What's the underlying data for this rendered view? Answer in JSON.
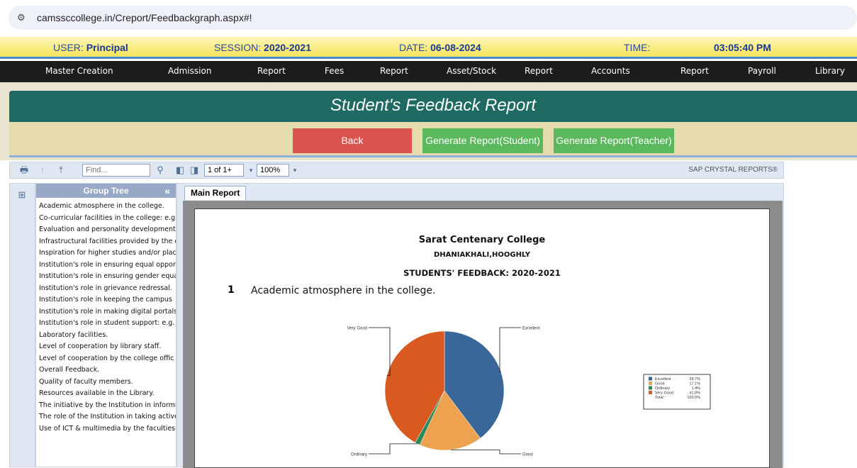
{
  "browser": {
    "url": "camssccollege.in/Creport/Feedbackgraph.aspx#!"
  },
  "info": {
    "user_label": "USER:",
    "user_value": "Principal",
    "session_label": "SESSION:",
    "session_value": "2020-2021",
    "date_label": "DATE:",
    "date_value": "06-08-2024",
    "time_label": "TIME:",
    "time_value": "03:05:40 PM"
  },
  "menu": [
    "Master Creation",
    "Admission",
    "Report",
    "Fees",
    "Report",
    "Asset/Stock",
    "Report",
    "Accounts",
    "Report",
    "Payroll",
    "Library"
  ],
  "page_title": "Student's Feedback Report",
  "buttons": {
    "back": "Back",
    "gen_student": "Generate Report(Student)",
    "gen_teacher": "Generate Report(Teacher)"
  },
  "toolbar": {
    "find_placeholder": "Find...",
    "page": "1 of 1+",
    "zoom": "100%",
    "brand": "SAP CRYSTAL REPORTS®"
  },
  "group_tree": {
    "title": "Group Tree",
    "items": [
      "Academic atmosphere in the college.",
      "Co-curricular facilities in the college: e.g",
      "Evaluation and personality development",
      "Infrastructural facilities provided by the c",
      "Inspiration for higher studies and/or plac",
      "Institution's role in ensuring equal oppor",
      "Institution's role in ensuring gender equa",
      "Institution's role in grievance redressal.",
      "Institution's role in keeping the campus",
      "Institution's role in making digital portals",
      "Institution's role in student support: e.g.",
      "Laboratory facilities.",
      "Level of cooperation by library staff.",
      "Level of cooperation by the college offic",
      "Overall Feedback.",
      "Quality of faculty members.",
      "Resources available in the Library.",
      "The initiative by the Institution in informi",
      "The role of the Institution in taking active",
      "Use of ICT & multimedia by the faculties"
    ]
  },
  "report": {
    "tab": "Main Report",
    "college": "Sarat Centenary College",
    "location": "DHANIAKHALI,HOOGHLY",
    "heading": "STUDENTS' FEEDBACK: 2020-2021",
    "q_num": "1",
    "q_text": "Academic atmosphere in the college."
  },
  "chart_data": {
    "type": "pie",
    "categories": [
      "Excellent",
      "Good",
      "Ordinary",
      "Very Good"
    ],
    "values": [
      39.7,
      17.1,
      1.4,
      41.8
    ],
    "colors": [
      "#3a6799",
      "#eda250",
      "#2a8a5a",
      "#d95a20"
    ],
    "legend_values": [
      "39.7%",
      "17.1%",
      "1.4%",
      "41.8%"
    ],
    "total_label": "Total:",
    "total_value": "100.0%",
    "legend_placement": "right"
  }
}
